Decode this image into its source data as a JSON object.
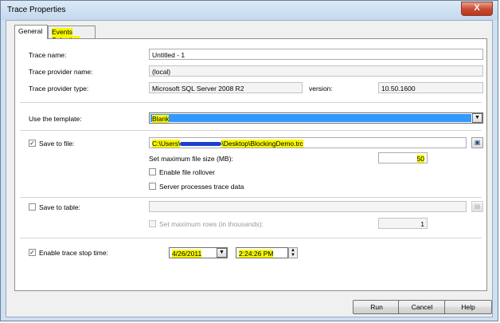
{
  "window": {
    "title": "Trace Properties",
    "close_glyph": "X"
  },
  "tabs": [
    {
      "label": "General",
      "active": true
    },
    {
      "label": "Events Selection",
      "active": false
    }
  ],
  "trace_name": {
    "label": "Trace name:",
    "value": "Untitled - 1"
  },
  "provider_name": {
    "label": "Trace provider name:",
    "value": "(local)"
  },
  "provider_type": {
    "label": "Trace provider type:",
    "value": "Microsoft SQL Server 2008 R2",
    "version_label": "version:",
    "version_value": "10.50.1600"
  },
  "template": {
    "label": "Use the template:",
    "value": "Blank"
  },
  "save_to_file": {
    "label": "Save to file:",
    "checked": true,
    "path": "C:\\Users\\",
    "path_rest": "\\Desktop\\BlockingDemo.trc",
    "max_size_label": "Set maximum file size (MB):",
    "max_size_value": "50",
    "rollover_label": "Enable file rollover",
    "server_processes_label": "Server processes trace data"
  },
  "save_to_table": {
    "label": "Save to table:",
    "checked": false,
    "max_rows_label": "Set maximum rows (in thousands):",
    "max_rows_value": "1"
  },
  "stop_time": {
    "label": "Enable trace stop time:",
    "checked": true,
    "date": "4/26/2011",
    "time": "2:24:26 PM"
  },
  "buttons": {
    "run": "Run",
    "cancel": "Cancel",
    "help": "Help"
  },
  "colors": {
    "highlight": "#f7f700",
    "selection": "#3399ff",
    "redaction": "#1a3fd1"
  },
  "icons": {
    "check": "✓",
    "dropdown": "▼",
    "spin_up": "▲",
    "spin_down": "▼"
  }
}
